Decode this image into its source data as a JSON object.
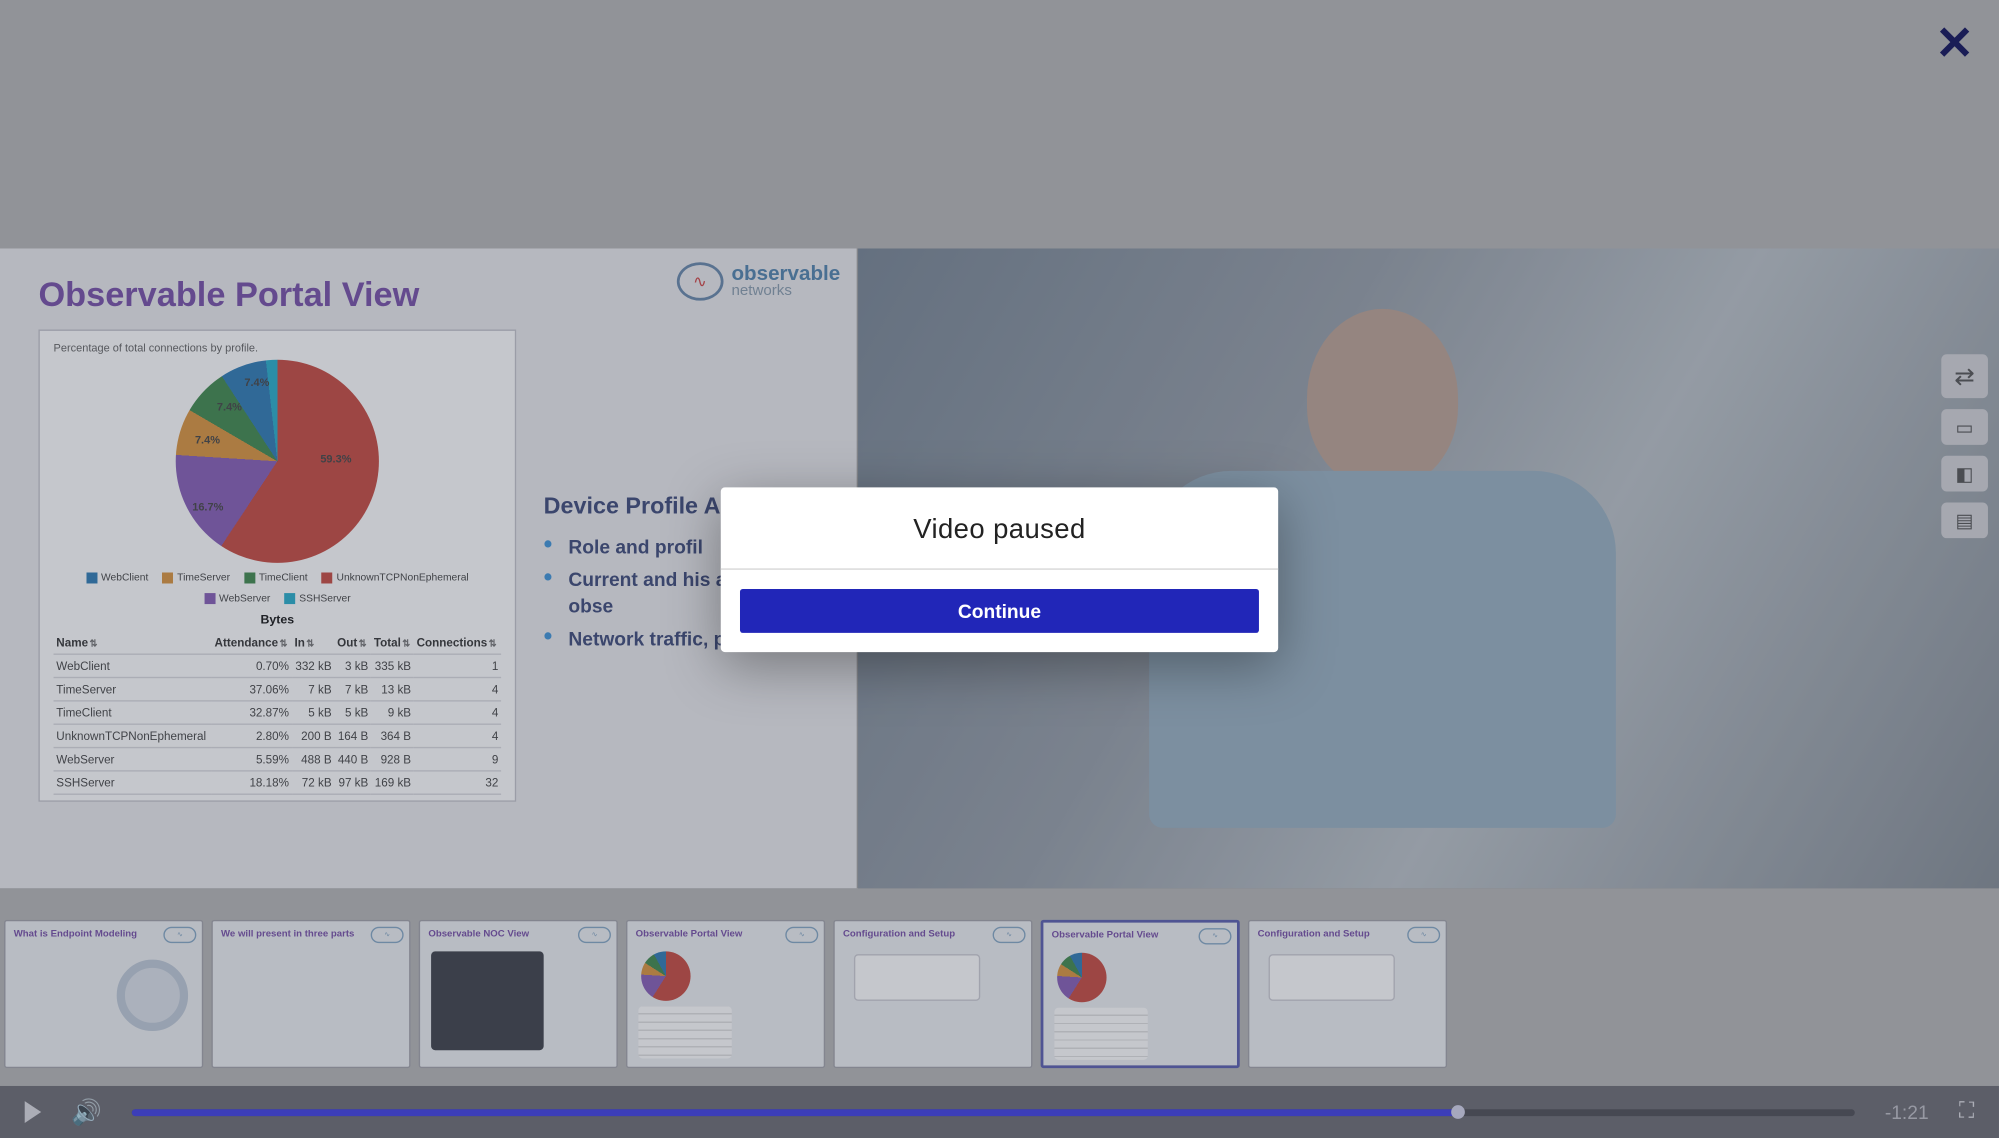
{
  "close_x": "✕",
  "modal": {
    "title": "Video paused",
    "button": "Continue"
  },
  "slide": {
    "title": "Observable Portal View",
    "logo_line1": "observable",
    "logo_line2": "networks",
    "chart_caption": "Percentage of total connections by profile.",
    "section_title": "Device Profile A",
    "bullets": [
      "Role and profil",
      "Current and his alerts and obse",
      "Network traffic, partners, etc"
    ],
    "bytes_title": "Bytes",
    "table": {
      "headers": [
        "Name",
        "Attendance",
        "In",
        "Out",
        "Total",
        "Connections"
      ],
      "rows": [
        [
          "WebClient",
          "0.70%",
          "332 kB",
          "3 kB",
          "335 kB",
          "1"
        ],
        [
          "TimeServer",
          "37.06%",
          "7 kB",
          "7 kB",
          "13 kB",
          "4"
        ],
        [
          "TimeClient",
          "32.87%",
          "5 kB",
          "5 kB",
          "9 kB",
          "4"
        ],
        [
          "UnknownTCPNonEphemeral",
          "2.80%",
          "200 B",
          "164 B",
          "364 B",
          "4"
        ],
        [
          "WebServer",
          "5.59%",
          "488 B",
          "440 B",
          "928 B",
          "9"
        ],
        [
          "SSHServer",
          "18.18%",
          "72 kB",
          "97 kB",
          "169 kB",
          "32"
        ]
      ]
    },
    "pie_labels": {
      "a": "59.3%",
      "b": "16.7%",
      "c": "7.4%",
      "d": "7.4%",
      "e": "7.4%"
    },
    "legend": [
      "WebClient",
      "TimeServer",
      "TimeClient",
      "UnknownTCPNonEphemeral",
      "WebServer",
      "SSHServer"
    ],
    "legend_colors": [
      "#1b6fae",
      "#d88a2b",
      "#2e7f3d",
      "#c23a2e",
      "#7b4fb0",
      "#13a6c7"
    ]
  },
  "side_tooltips": {
    "swap": "Swap layout",
    "a": "Layout A",
    "b": "Layout B",
    "c": "Layout C"
  },
  "thumbs": [
    {
      "title": "What is Endpoint Modeling"
    },
    {
      "title": "We will present in three parts"
    },
    {
      "title": "Observable NOC View"
    },
    {
      "title": "Observable Portal View"
    },
    {
      "title": "Configuration and Setup"
    },
    {
      "title": "Observable Portal View"
    },
    {
      "title": "Configuration and Setup"
    }
  ],
  "player": {
    "time_remaining": "-1:21"
  },
  "chart_data": {
    "type": "pie",
    "title": "Percentage of total connections by profile.",
    "categories": [
      "WebClient",
      "TimeServer",
      "TimeClient",
      "UnknownTCPNonEphemeral",
      "WebServer",
      "SSHServer"
    ],
    "values": [
      59.3,
      16.7,
      7.4,
      7.4,
      7.4,
      1.8
    ],
    "colors": [
      "#c23a2e",
      "#7b4fb0",
      "#d88a2b",
      "#2e7f3d",
      "#1b6fae",
      "#13a6c7"
    ]
  }
}
